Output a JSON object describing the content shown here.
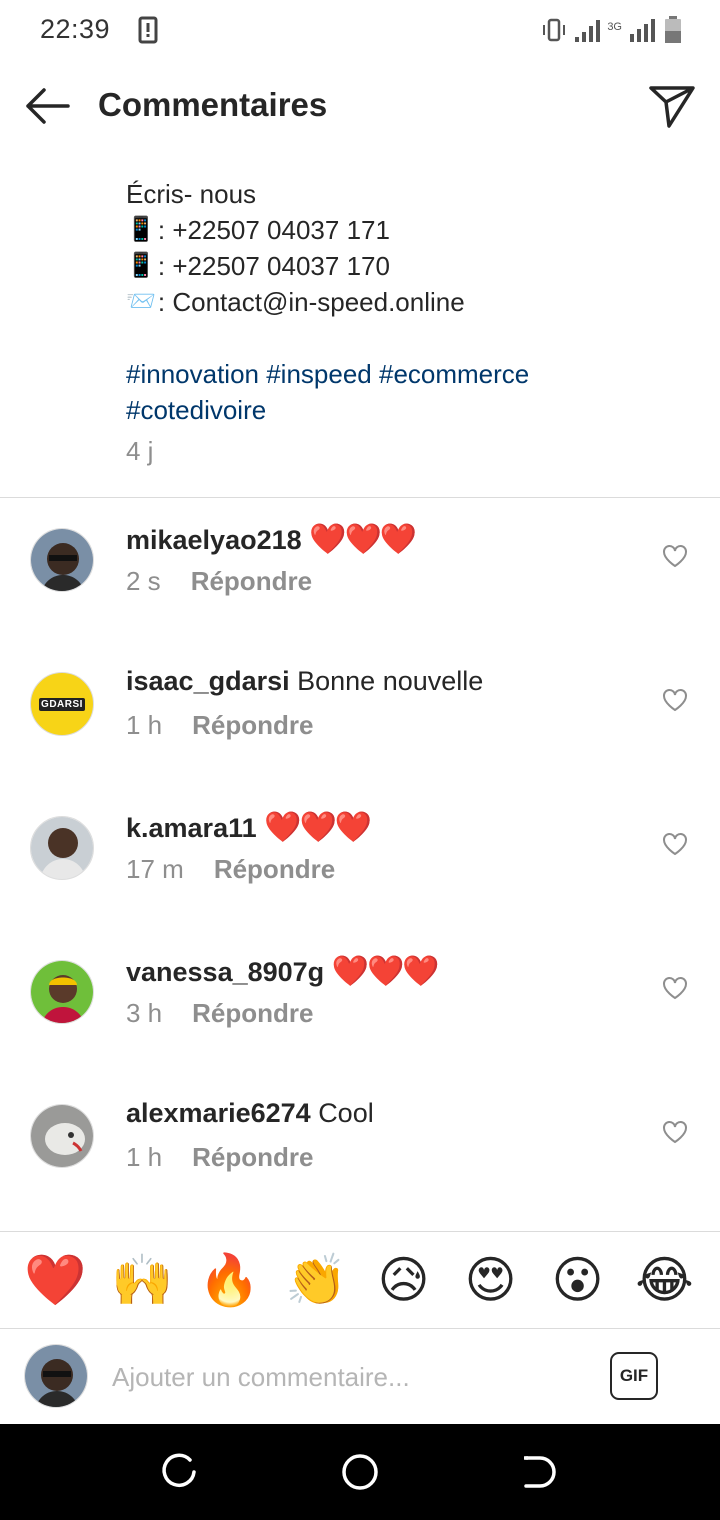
{
  "status_bar": {
    "time": "22:39",
    "network": "3G"
  },
  "header": {
    "title": "Commentaires"
  },
  "caption": {
    "lines": [
      {
        "icon": "",
        "text": "Écris- nous"
      },
      {
        "icon": "📱",
        "text": ": +22507 04037 171"
      },
      {
        "icon": "📱",
        "text": ": +22507 04037 170"
      },
      {
        "icon": "📨",
        "text": ": Contact@in-speed.online"
      }
    ],
    "hashtags_line1": "#innovation #inspeed #ecommerce",
    "hashtags_line2": "#cotedivoire",
    "time": "4 j"
  },
  "comments": [
    {
      "user": "mikaelyao218",
      "text": "❤️❤️❤️",
      "time": "2 s",
      "reply": "Répondre"
    },
    {
      "user": "isaac_gdarsi",
      "text": "Bonne nouvelle",
      "time": "1 h",
      "reply": "Répondre",
      "avatar_text": "GDARSI"
    },
    {
      "user": "k.amara11",
      "text": "❤️❤️❤️",
      "time": "17 m",
      "reply": "Répondre"
    },
    {
      "user": "vanessa_8907g",
      "text": "❤️❤️❤️",
      "time": "3 h",
      "reply": "Répondre"
    },
    {
      "user": "alexmarie6274",
      "text": "Cool",
      "time": "1 h",
      "reply": "Répondre"
    }
  ],
  "reactions": [
    "❤️",
    "🙌",
    "🔥",
    "👏",
    "😥",
    "😍",
    "😮",
    "😂"
  ],
  "input": {
    "placeholder": "Ajouter un commentaire...",
    "gif_label": "GIF"
  },
  "colors": {
    "hashtag": "#00376b",
    "muted": "#8e8e8e",
    "heart": "#e0242c",
    "divider": "#dbdbdb"
  }
}
